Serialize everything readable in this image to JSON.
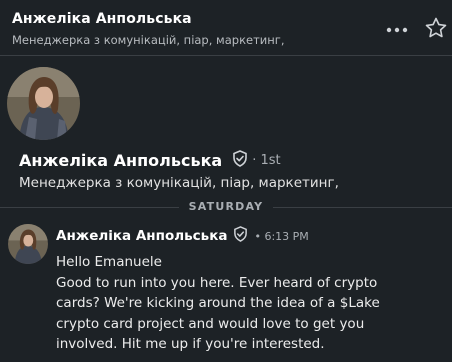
{
  "header": {
    "name": "Анжеліка Анпольська",
    "subtitle": "Менеджерка з комунікацій, піар, маркетинг,",
    "more_icon": "more-horizontal-icon",
    "star_icon": "star-outline-icon"
  },
  "profile": {
    "name": "Анжеліка Анпольська",
    "degree": "· 1st",
    "headline": "Менеджерка з комунікацій, піар, маркетинг,"
  },
  "day_separator": "SATURDAY",
  "message": {
    "sender": "Анжеліка Анпольська",
    "time": "• 6:13 PM",
    "lines": [
      "Hello Emanuele",
      "Good to run into you here. Ever heard of crypto",
      "cards? We're kicking around the idea of a $Lake",
      "crypto card project and would love to get you",
      "involved. Hit me up if you're interested."
    ]
  },
  "colors": {
    "background": "#1d2226",
    "text": "#e8e8e8",
    "muted": "#a9aeb3",
    "divider": "#3a3f44"
  }
}
